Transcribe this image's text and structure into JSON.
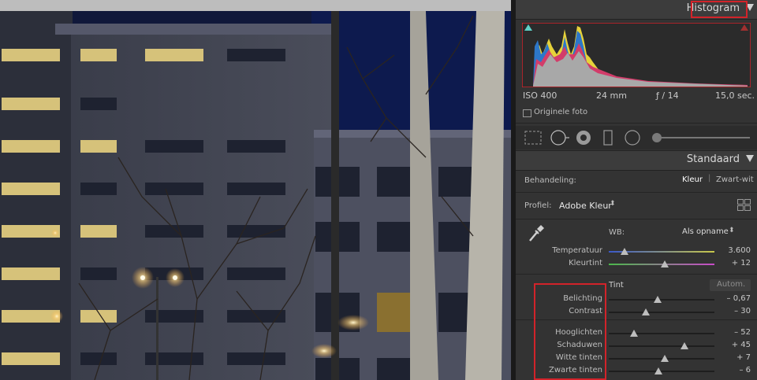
{
  "histogram": {
    "title": "Histogram",
    "iso": "ISO 400",
    "focal": "24 mm",
    "aperture": "ƒ / 14",
    "shutter": "15,0 sec.",
    "original_photo_label": "Originele foto"
  },
  "standaard": {
    "title": "Standaard",
    "treatment_label": "Behandeling:",
    "treatment_color": "Kleur",
    "treatment_bw": "Zwart-wit",
    "profile_label": "Profiel:",
    "profile_value": "Adobe Kleur",
    "wb_label": "WB:",
    "wb_value": "Als opname",
    "tone_label": "Tint",
    "auto_label": "Autom."
  },
  "wb_sliders": [
    {
      "label": "Temperatuur",
      "value": "3.600",
      "position": 0.15
    },
    {
      "label": "Kleurtint",
      "value": "+ 12",
      "position": 0.53
    }
  ],
  "tone_sliders": [
    {
      "label": "Belichting",
      "value": "– 0,67",
      "position": 0.46
    },
    {
      "label": "Contrast",
      "value": "– 30",
      "position": 0.35
    }
  ],
  "presence_sliders": [
    {
      "label": "Hooglichten",
      "value": "– 52",
      "position": 0.24
    },
    {
      "label": "Schaduwen",
      "value": "+ 45",
      "position": 0.72
    },
    {
      "label": "Witte tinten",
      "value": "+ 7",
      "position": 0.53
    },
    {
      "label": "Zwarte tinten",
      "value": "– 6",
      "position": 0.47
    }
  ],
  "colors": {
    "highlight_box": "#d2232a",
    "panel_bg": "#333333",
    "header_bg": "#3c3c3c"
  }
}
